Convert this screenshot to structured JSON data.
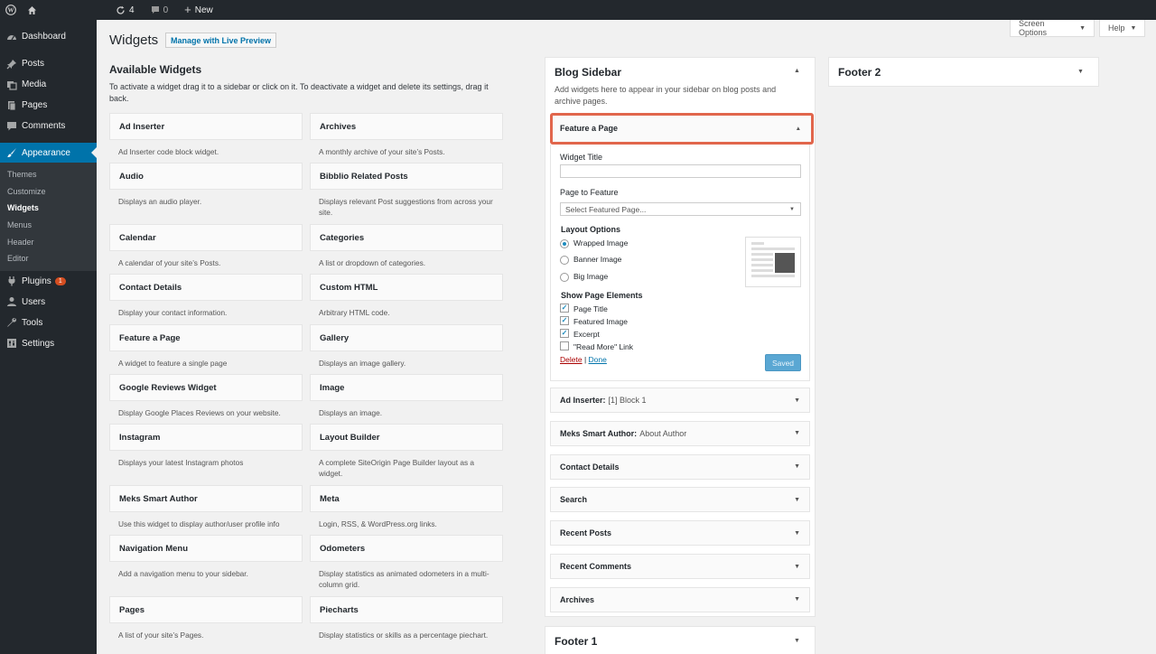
{
  "adminbar": {
    "updates_count": "4",
    "comments_count": "0",
    "new_label": "New"
  },
  "menu": {
    "dashboard": "Dashboard",
    "posts": "Posts",
    "media": "Media",
    "pages": "Pages",
    "comments": "Comments",
    "appearance": "Appearance",
    "submenu": [
      "Themes",
      "Customize",
      "Widgets",
      "Menus",
      "Header",
      "Editor"
    ],
    "plugins": "Plugins",
    "plugins_badge": "1",
    "users": "Users",
    "tools": "Tools",
    "settings": "Settings"
  },
  "top_buttons": {
    "screen_options": "Screen Options",
    "help": "Help"
  },
  "header": {
    "title": "Widgets",
    "live_preview": "Manage with Live Preview"
  },
  "available": {
    "title": "Available Widgets",
    "description": "To activate a widget drag it to a sidebar or click on it. To deactivate a widget and delete its settings, drag it back.",
    "left": [
      {
        "name": "Ad Inserter",
        "desc": "Ad Inserter code block widget."
      },
      {
        "name": "Audio",
        "desc": "Displays an audio player."
      },
      {
        "name": "Calendar",
        "desc": "A calendar of your site’s Posts."
      },
      {
        "name": "Contact Details",
        "desc": "Display your contact information."
      },
      {
        "name": "Feature a Page",
        "desc": "A widget to feature a single page"
      },
      {
        "name": "Google Reviews Widget",
        "desc": "Display Google Places Reviews on your website."
      },
      {
        "name": "Instagram",
        "desc": "Displays your latest Instagram photos"
      },
      {
        "name": "Meks Smart Author",
        "desc": "Use this widget to display author/user profile info"
      },
      {
        "name": "Navigation Menu",
        "desc": "Add a navigation menu to your sidebar."
      },
      {
        "name": "Pages",
        "desc": "A list of your site’s Pages."
      }
    ],
    "right": [
      {
        "name": "Archives",
        "desc": "A monthly archive of your site’s Posts."
      },
      {
        "name": "Bibblio Related Posts",
        "desc": "Displays relevant Post suggestions from across your site."
      },
      {
        "name": "Categories",
        "desc": "A list or dropdown of categories."
      },
      {
        "name": "Custom HTML",
        "desc": "Arbitrary HTML code."
      },
      {
        "name": "Gallery",
        "desc": "Displays an image gallery."
      },
      {
        "name": "Image",
        "desc": "Displays an image."
      },
      {
        "name": "Layout Builder",
        "desc": "A complete SiteOrigin Page Builder layout as a widget."
      },
      {
        "name": "Meta",
        "desc": "Login, RSS, & WordPress.org links."
      },
      {
        "name": "Odometers",
        "desc": "Display statistics as animated odometers in a multi-column grid."
      },
      {
        "name": "Piecharts",
        "desc": "Display statistics or skills as a percentage piechart."
      }
    ]
  },
  "blog_sidebar": {
    "title": "Blog Sidebar",
    "description": "Add widgets here to appear in your sidebar on blog posts and archive pages.",
    "feature": {
      "title": "Feature a Page",
      "widget_title_label": "Widget Title",
      "widget_title_value": "",
      "page_label": "Page to Feature",
      "page_placeholder": "Select Featured Page...",
      "layout_label": "Layout Options",
      "layouts": [
        "Wrapped Image",
        "Banner Image",
        "Big Image"
      ],
      "elements_label": "Show Page Elements",
      "elements": [
        "Page Title",
        "Featured Image",
        "Excerpt",
        "\"Read More\" Link"
      ],
      "delete_label": "Delete",
      "separator": "|",
      "done_label": "Done",
      "saved_label": "Saved"
    },
    "widgets": [
      {
        "name": "Ad Inserter:",
        "sub": "[1] Block 1"
      },
      {
        "name": "Meks Smart Author:",
        "sub": "About Author"
      },
      {
        "name": "Contact Details",
        "sub": ""
      },
      {
        "name": "Search",
        "sub": ""
      },
      {
        "name": "Recent Posts",
        "sub": ""
      },
      {
        "name": "Recent Comments",
        "sub": ""
      },
      {
        "name": "Archives",
        "sub": ""
      }
    ]
  },
  "footer1": {
    "title": "Footer 1"
  },
  "footer2": {
    "title": "Footer 2"
  }
}
